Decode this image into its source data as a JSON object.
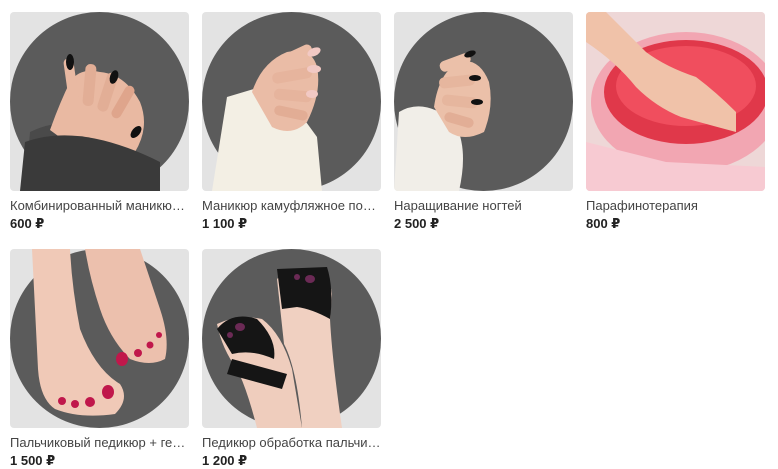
{
  "products": [
    {
      "title": "Комбинированный маникю…",
      "price": "600 ₽",
      "image": "manicure-dark-nails-photo"
    },
    {
      "title": "Маникюр камуфляжное по…",
      "price": "1 100 ₽",
      "image": "manicure-nude-nails-photo"
    },
    {
      "title": "Наращивание ногтей",
      "price": "2 500 ₽",
      "image": "nail-extension-photo"
    },
    {
      "title": "Парафинотерапия",
      "price": "800 ₽",
      "image": "paraffin-bath-photo"
    },
    {
      "title": "Пальчиковый педикюр + ге…",
      "price": "1 500 ₽",
      "image": "pedicure-red-toes-photo"
    },
    {
      "title": "Педикюр обработка пальчи…",
      "price": "1 200 ₽",
      "image": "pedicure-black-sandals-photo"
    }
  ]
}
